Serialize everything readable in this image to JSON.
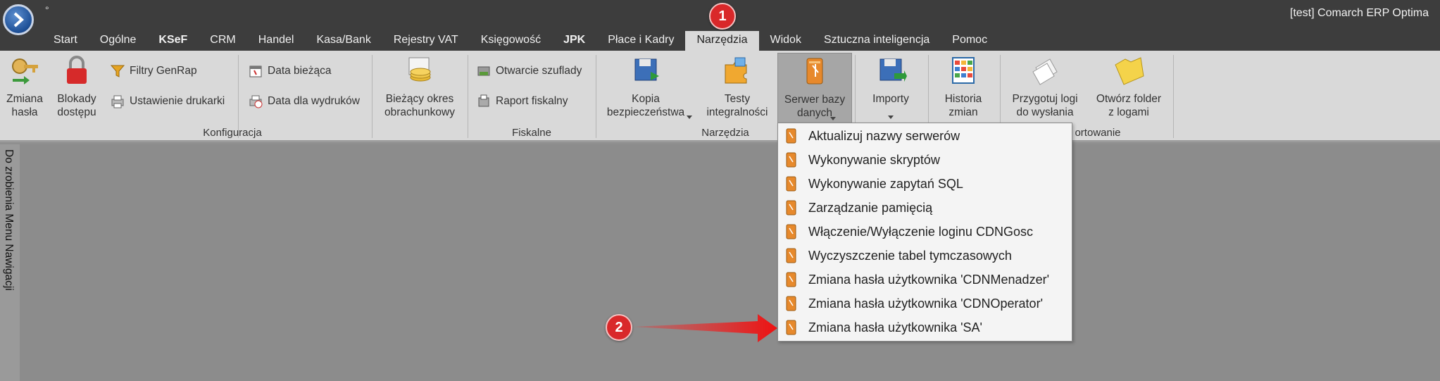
{
  "window": {
    "title": "[test] Comarch ERP Optima",
    "modified_marker": "°"
  },
  "tabs": [
    {
      "label": "Start",
      "bold": false
    },
    {
      "label": "Ogólne",
      "bold": false
    },
    {
      "label": "KSeF",
      "bold": true
    },
    {
      "label": "CRM",
      "bold": false
    },
    {
      "label": "Handel",
      "bold": false
    },
    {
      "label": "Kasa/Bank",
      "bold": false
    },
    {
      "label": "Rejestry VAT",
      "bold": false
    },
    {
      "label": "Księgowość",
      "bold": false
    },
    {
      "label": "JPK",
      "bold": true
    },
    {
      "label": "Płace i Kadry",
      "bold": false
    },
    {
      "label": "Narzędzia",
      "bold": false,
      "active": true
    },
    {
      "label": "Widok",
      "bold": false
    },
    {
      "label": "Sztuczna inteligencja",
      "bold": false
    },
    {
      "label": "Pomoc",
      "bold": false
    }
  ],
  "ribbon": {
    "zmiana_hasla": "Zmiana\nhasła",
    "blokady": "Blokady\ndostępu",
    "filtry": "Filtry GenRap",
    "ustawienie": "Ustawienie drukarki",
    "data_biezaca": "Data bieżąca",
    "data_wydrukow": "Data dla wydruków",
    "okres": "Bieżący okres\nobrachunkowy",
    "otwarcie": "Otwarcie szuflady",
    "raport": "Raport fiskalny",
    "kopia": "Kopia\nbezpieczeństwa",
    "testy": "Testy\nintegralności",
    "serwer": "Serwer bazy\ndanych",
    "importy": "Importy",
    "historia": "Historia\nzmian",
    "przygotuj": "Przygotuj logi\ndo wysłania",
    "otworz": "Otwórz folder\nz logami",
    "groups": {
      "konfiguracja": "Konfiguracja",
      "fiskalne": "Fiskalne",
      "narzedzia": "Narzędzia",
      "importowanie": "ortowanie"
    }
  },
  "side_panel": {
    "label": "Do zrobienia   Menu Nawigacji"
  },
  "dropdown_menu": [
    "Aktualizuj nazwy serwerów",
    "Wykonywanie skryptów",
    "Wykonywanie zapytań SQL",
    "Zarządzanie pamięcią",
    "Włączenie/Wyłączenie loginu CDNGosc",
    "Wyczyszczenie tabel tymczasowych",
    "Zmiana hasła użytkownika 'CDNMenadzer'",
    "Zmiana hasła użytkownika 'CDNOperator'",
    "Zmiana hasła użytkownika 'SA'"
  ],
  "annotations": {
    "badge1": "1",
    "badge2": "2"
  },
  "colors": {
    "accent_red": "#d9282a",
    "ribbon_bg": "#d9d9d9",
    "titlebar_bg": "#3d3d3d"
  }
}
